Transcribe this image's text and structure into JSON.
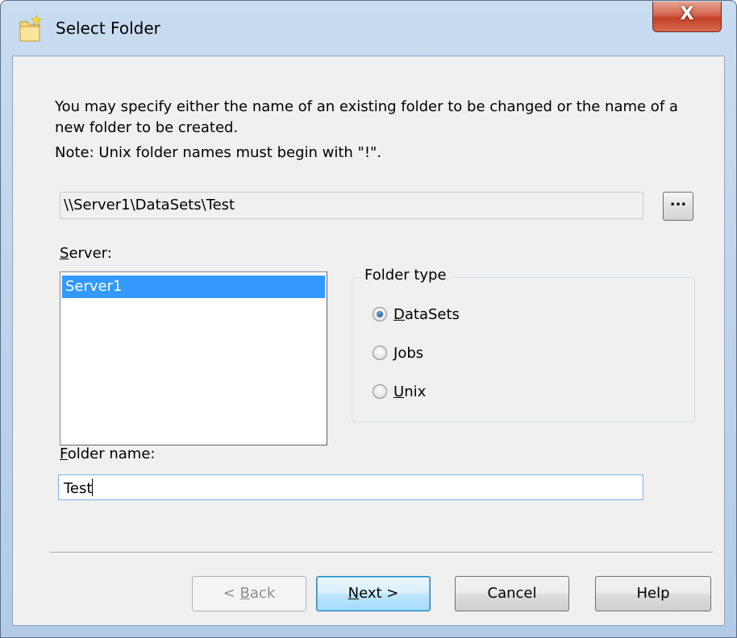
{
  "window": {
    "title": "Select Folder",
    "close_label": "X"
  },
  "description": "You may specify either the name of an existing folder to be changed or the name of a new folder to be created.",
  "note": "Note: Unix folder names must begin with \"!\".",
  "path_field": {
    "value": "\\\\Server1\\DataSets\\Test",
    "browse_label": "..."
  },
  "server": {
    "label_first": "S",
    "label_rest": "erver:",
    "items": [
      "Server1"
    ],
    "selected": "Server1"
  },
  "folder_type": {
    "title": "Folder type",
    "options": [
      {
        "first": "D",
        "rest": "ataSets",
        "checked": true
      },
      {
        "first": "J",
        "rest": "obs",
        "checked": false
      },
      {
        "first": "U",
        "rest": "nix",
        "checked": false
      }
    ]
  },
  "folder_name": {
    "label_first": "F",
    "label_rest": "older name:",
    "value": "Test"
  },
  "buttons": {
    "back_prefix": "< ",
    "back_first": "B",
    "back_rest": "ack",
    "next_first": "N",
    "next_rest": "ext >",
    "cancel": "Cancel",
    "help": "Help"
  },
  "colors": {
    "selection": "#3399ff",
    "default_button_border": "#3c7fb1",
    "close_button": "#c3412a"
  }
}
